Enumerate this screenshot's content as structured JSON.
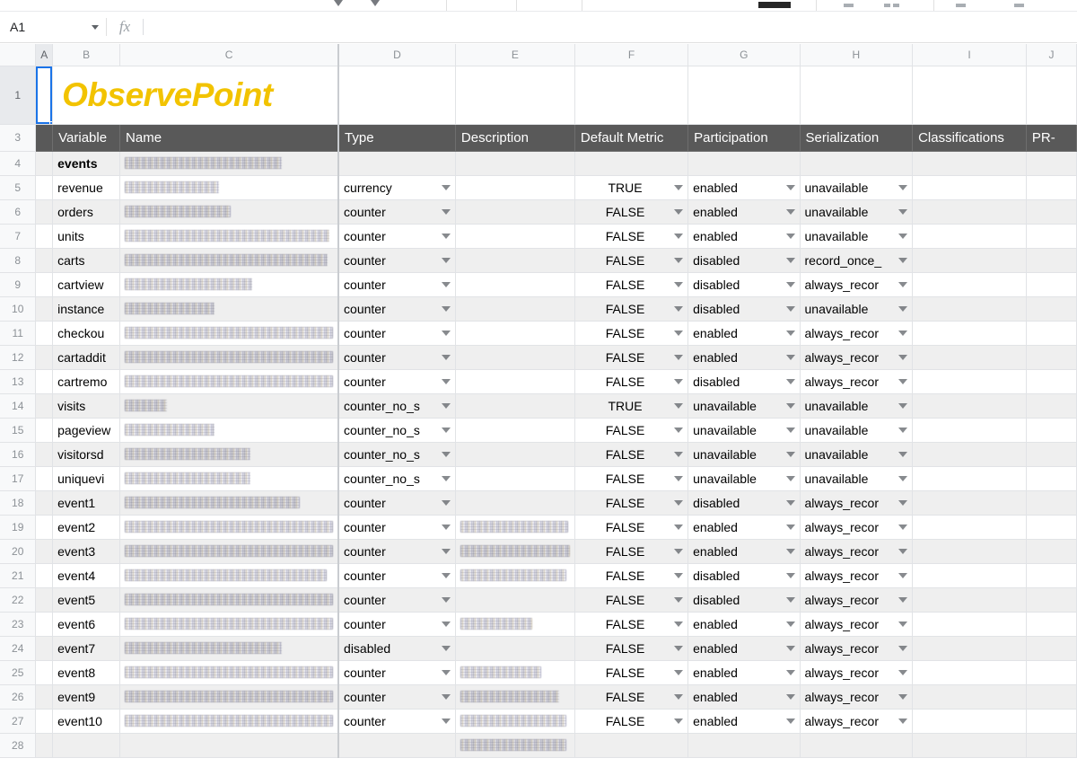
{
  "app": {
    "name_box_value": "A1",
    "name_box_caret": "chevron-down-icon",
    "fx_label": "fx",
    "formula_value": "",
    "formula_placeholder": ""
  },
  "toolbar": {
    "icons": [
      "undo-icon",
      "redo-icon",
      "fill-color-icon",
      "borders-icon",
      "merge-icon",
      "align-icon"
    ]
  },
  "grid": {
    "column_headers": [
      "A",
      "B",
      "C",
      "D",
      "E",
      "F",
      "G",
      "H",
      "I",
      "J"
    ],
    "selected_column": "A",
    "selected_row": "1",
    "row_numbers": [
      "1",
      "3",
      "4",
      "5",
      "6",
      "7",
      "8",
      "9",
      "10",
      "11",
      "12",
      "13",
      "14",
      "15",
      "16",
      "17",
      "18",
      "19",
      "20",
      "21",
      "22",
      "23",
      "24",
      "25",
      "26",
      "27",
      "28"
    ],
    "logo_text": "ObservePoint",
    "header_band": {
      "variable": "Variable",
      "name": "Name",
      "type": "Type",
      "description": "Description",
      "default_metric": "Default Metric",
      "participation": "Participation",
      "serialization": "Serialization",
      "classifications": "Classifications",
      "pr": "PR-"
    },
    "rows": [
      {
        "row": "4",
        "variable": "events",
        "name_redacted": true,
        "name_w": 175,
        "type": "",
        "desc_redacted": false,
        "desc_w": 0,
        "default_metric": "",
        "participation": "",
        "serialization": ""
      },
      {
        "row": "5",
        "variable": "revenue",
        "name_redacted": true,
        "name_w": 105,
        "type": "currency",
        "desc_redacted": false,
        "desc_w": 0,
        "default_metric": "TRUE",
        "participation": "enabled",
        "serialization": "unavailable"
      },
      {
        "row": "6",
        "variable": "orders",
        "name_redacted": true,
        "name_w": 118,
        "type": "counter",
        "desc_redacted": false,
        "desc_w": 0,
        "default_metric": "FALSE",
        "participation": "enabled",
        "serialization": "unavailable"
      },
      {
        "row": "7",
        "variable": "units",
        "name_redacted": true,
        "name_w": 228,
        "type": "counter",
        "desc_redacted": false,
        "desc_w": 0,
        "default_metric": "FALSE",
        "participation": "enabled",
        "serialization": "unavailable"
      },
      {
        "row": "8",
        "variable": "carts",
        "name_redacted": true,
        "name_w": 226,
        "type": "counter",
        "desc_redacted": false,
        "desc_w": 0,
        "default_metric": "FALSE",
        "participation": "disabled",
        "serialization": "record_once_"
      },
      {
        "row": "9",
        "variable": "cartview",
        "name_redacted": true,
        "name_w": 142,
        "type": "counter",
        "desc_redacted": false,
        "desc_w": 0,
        "default_metric": "FALSE",
        "participation": "disabled",
        "serialization": "always_recor"
      },
      {
        "row": "10",
        "variable": "instance",
        "name_redacted": true,
        "name_w": 100,
        "type": "counter",
        "desc_redacted": false,
        "desc_w": 0,
        "default_metric": "FALSE",
        "participation": "disabled",
        "serialization": "unavailable"
      },
      {
        "row": "11",
        "variable": "checkou",
        "name_redacted": true,
        "name_w": 232,
        "type": "counter",
        "desc_redacted": false,
        "desc_w": 0,
        "default_metric": "FALSE",
        "participation": "enabled",
        "serialization": "always_recor"
      },
      {
        "row": "12",
        "variable": "cartaddit",
        "name_redacted": true,
        "name_w": 232,
        "type": "counter",
        "desc_redacted": false,
        "desc_w": 0,
        "default_metric": "FALSE",
        "participation": "enabled",
        "serialization": "always_recor"
      },
      {
        "row": "13",
        "variable": "cartremo",
        "name_redacted": true,
        "name_w": 232,
        "type": "counter",
        "desc_redacted": false,
        "desc_w": 0,
        "default_metric": "FALSE",
        "participation": "disabled",
        "serialization": "always_recor"
      },
      {
        "row": "14",
        "variable": "visits",
        "name_redacted": true,
        "name_w": 47,
        "type": "counter_no_s",
        "desc_redacted": false,
        "desc_w": 0,
        "default_metric": "TRUE",
        "participation": "unavailable",
        "serialization": "unavailable"
      },
      {
        "row": "15",
        "variable": "pageview",
        "name_redacted": true,
        "name_w": 100,
        "type": "counter_no_s",
        "desc_redacted": false,
        "desc_w": 0,
        "default_metric": "FALSE",
        "participation": "unavailable",
        "serialization": "unavailable"
      },
      {
        "row": "16",
        "variable": "visitorsd",
        "name_redacted": true,
        "name_w": 140,
        "type": "counter_no_s",
        "desc_redacted": false,
        "desc_w": 0,
        "default_metric": "FALSE",
        "participation": "unavailable",
        "serialization": "unavailable"
      },
      {
        "row": "17",
        "variable": "uniquevi",
        "name_redacted": true,
        "name_w": 140,
        "type": "counter_no_s",
        "desc_redacted": false,
        "desc_w": 0,
        "default_metric": "FALSE",
        "participation": "unavailable",
        "serialization": "unavailable"
      },
      {
        "row": "18",
        "variable": "event1",
        "name_redacted": true,
        "name_w": 195,
        "type": "counter",
        "desc_redacted": false,
        "desc_w": 0,
        "default_metric": "FALSE",
        "participation": "disabled",
        "serialization": "always_recor"
      },
      {
        "row": "19",
        "variable": "event2",
        "name_redacted": true,
        "name_w": 232,
        "type": "counter",
        "desc_redacted": true,
        "desc_w": 120,
        "default_metric": "FALSE",
        "participation": "enabled",
        "serialization": "always_recor"
      },
      {
        "row": "20",
        "variable": "event3",
        "name_redacted": true,
        "name_w": 232,
        "type": "counter",
        "desc_redacted": true,
        "desc_w": 122,
        "default_metric": "FALSE",
        "participation": "enabled",
        "serialization": "always_recor"
      },
      {
        "row": "21",
        "variable": "event4",
        "name_redacted": true,
        "name_w": 225,
        "type": "counter",
        "desc_redacted": true,
        "desc_w": 118,
        "default_metric": "FALSE",
        "participation": "disabled",
        "serialization": "always_recor"
      },
      {
        "row": "22",
        "variable": "event5",
        "name_redacted": true,
        "name_w": 232,
        "type": "counter",
        "desc_redacted": false,
        "desc_w": 0,
        "default_metric": "FALSE",
        "participation": "disabled",
        "serialization": "always_recor"
      },
      {
        "row": "23",
        "variable": "event6",
        "name_redacted": true,
        "name_w": 232,
        "type": "counter",
        "desc_redacted": true,
        "desc_w": 80,
        "default_metric": "FALSE",
        "participation": "enabled",
        "serialization": "always_recor"
      },
      {
        "row": "24",
        "variable": "event7",
        "name_redacted": true,
        "name_w": 175,
        "type": "disabled",
        "desc_redacted": false,
        "desc_w": 0,
        "default_metric": "FALSE",
        "participation": "enabled",
        "serialization": "always_recor"
      },
      {
        "row": "25",
        "variable": "event8",
        "name_redacted": true,
        "name_w": 232,
        "type": "counter",
        "desc_redacted": true,
        "desc_w": 90,
        "default_metric": "FALSE",
        "participation": "enabled",
        "serialization": "always_recor"
      },
      {
        "row": "26",
        "variable": "event9",
        "name_redacted": true,
        "name_w": 232,
        "type": "counter",
        "desc_redacted": true,
        "desc_w": 110,
        "default_metric": "FALSE",
        "participation": "enabled",
        "serialization": "always_recor"
      },
      {
        "row": "27",
        "variable": "event10",
        "name_redacted": true,
        "name_w": 232,
        "type": "counter",
        "desc_redacted": true,
        "desc_w": 118,
        "default_metric": "FALSE",
        "participation": "enabled",
        "serialization": "always_recor"
      },
      {
        "row": "28",
        "variable": "",
        "name_redacted": false,
        "name_w": 0,
        "type": "",
        "desc_redacted": true,
        "desc_w": 118,
        "default_metric": "",
        "participation": "",
        "serialization": ""
      }
    ]
  },
  "colors": {
    "header_band_bg": "#595959",
    "logo": "#f2c300",
    "selection": "#1a73e8",
    "shade_row": "#efefef"
  }
}
